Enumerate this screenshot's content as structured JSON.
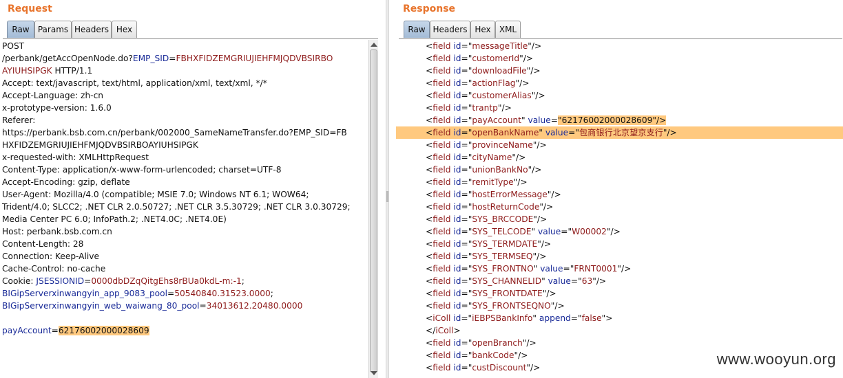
{
  "request": {
    "title": "Request",
    "tabs": [
      "Raw",
      "Params",
      "Headers",
      "Hex"
    ],
    "active_tab": "Raw",
    "lines": [
      [
        {
          "t": "POST"
        }
      ],
      [
        {
          "t": "/perbank/getAccOpenNode.do?"
        },
        {
          "t": "EMP_SID",
          "c": "k"
        },
        {
          "t": "="
        },
        {
          "t": "FBHXFIDZEMGRIUJIEHFMJQDVBSIRBO",
          "c": "v"
        }
      ],
      [
        {
          "t": "AYIUHSIPGK",
          "c": "v"
        },
        {
          "t": " HTTP/1.1"
        }
      ],
      [
        {
          "t": "Accept: text/javascript, text/html, application/xml, text/xml, */*"
        }
      ],
      [
        {
          "t": "Accept-Language: zh-cn"
        }
      ],
      [
        {
          "t": "x-prototype-version: 1.6.0"
        }
      ],
      [
        {
          "t": "Referer:"
        }
      ],
      [
        {
          "t": "https://perbank.bsb.com.cn/perbank/002000_SameNameTransfer.do?EMP_SID=FB"
        }
      ],
      [
        {
          "t": "HXFIDZEMGRIUJIEHFMJQDVBSIRBOAYIUHSIPGK"
        }
      ],
      [
        {
          "t": "x-requested-with: XMLHttpRequest"
        }
      ],
      [
        {
          "t": "Content-Type: application/x-www-form-urlencoded; charset=UTF-8"
        }
      ],
      [
        {
          "t": "Accept-Encoding: gzip, deflate"
        }
      ],
      [
        {
          "t": "User-Agent: Mozilla/4.0 (compatible; MSIE 7.0; Windows NT 6.1; WOW64;"
        }
      ],
      [
        {
          "t": "Trident/4.0; SLCC2; .NET CLR 2.0.50727; .NET CLR 3.5.30729; .NET CLR 3.0.30729;"
        }
      ],
      [
        {
          "t": "Media Center PC 6.0; InfoPath.2; .NET4.0C; .NET4.0E)"
        }
      ],
      [
        {
          "t": "Host: perbank.bsb.com.cn"
        }
      ],
      [
        {
          "t": "Content-Length: 28"
        }
      ],
      [
        {
          "t": "Connection: Keep-Alive"
        }
      ],
      [
        {
          "t": "Cache-Control: no-cache"
        }
      ],
      [
        {
          "t": "Cookie: "
        },
        {
          "t": "JSESSIONID",
          "c": "k"
        },
        {
          "t": "="
        },
        {
          "t": "0000dbDZqQitgEhs8rBUa0kdL-m:-1",
          "c": "v"
        },
        {
          "t": ";"
        }
      ],
      [
        {
          "t": "BIGipServerxinwangyin_app_9083_pool",
          "c": "k"
        },
        {
          "t": "="
        },
        {
          "t": "50540840.31523.0000",
          "c": "v"
        },
        {
          "t": ";"
        }
      ],
      [
        {
          "t": "BIGipServerxinwangyin_web_waiwang_80_pool",
          "c": "k"
        },
        {
          "t": "="
        },
        {
          "t": "34013612.20480.0000",
          "c": "v"
        }
      ],
      [
        {
          "t": ""
        }
      ],
      [
        {
          "t": "payAccount",
          "c": "k"
        },
        {
          "t": "="
        },
        {
          "t": "62176002000028609",
          "c": "hl"
        }
      ]
    ]
  },
  "response": {
    "title": "Response",
    "tabs": [
      "Raw",
      "Headers",
      "Hex",
      "XML"
    ],
    "active_tab": "Raw",
    "lines": [
      [
        {
          "t": "<"
        },
        {
          "t": "field",
          "c": "v"
        },
        {
          "t": " "
        },
        {
          "t": "id",
          "c": "k"
        },
        {
          "t": "=\""
        },
        {
          "t": "messageTitle",
          "c": "v"
        },
        {
          "t": "\"/>"
        }
      ],
      [
        {
          "t": "<"
        },
        {
          "t": "field",
          "c": "v"
        },
        {
          "t": " "
        },
        {
          "t": "id",
          "c": "k"
        },
        {
          "t": "=\""
        },
        {
          "t": "customerId",
          "c": "v"
        },
        {
          "t": "\"/>"
        }
      ],
      [
        {
          "t": "<"
        },
        {
          "t": "field",
          "c": "v"
        },
        {
          "t": " "
        },
        {
          "t": "id",
          "c": "k"
        },
        {
          "t": "=\""
        },
        {
          "t": "downloadFile",
          "c": "v"
        },
        {
          "t": "\"/>"
        }
      ],
      [
        {
          "t": "<"
        },
        {
          "t": "field",
          "c": "v"
        },
        {
          "t": " "
        },
        {
          "t": "id",
          "c": "k"
        },
        {
          "t": "=\""
        },
        {
          "t": "actionFlag",
          "c": "v"
        },
        {
          "t": "\"/>"
        }
      ],
      [
        {
          "t": "<"
        },
        {
          "t": "field",
          "c": "v"
        },
        {
          "t": " "
        },
        {
          "t": "id",
          "c": "k"
        },
        {
          "t": "=\""
        },
        {
          "t": "customerAlias",
          "c": "v"
        },
        {
          "t": "\"/>"
        }
      ],
      [
        {
          "t": "<"
        },
        {
          "t": "field",
          "c": "v"
        },
        {
          "t": " "
        },
        {
          "t": "id",
          "c": "k"
        },
        {
          "t": "=\""
        },
        {
          "t": "trantp",
          "c": "v"
        },
        {
          "t": "\"/>"
        }
      ],
      [
        {
          "t": "<"
        },
        {
          "t": "field",
          "c": "v"
        },
        {
          "t": " "
        },
        {
          "t": "id",
          "c": "k"
        },
        {
          "t": "=\""
        },
        {
          "t": "payAccount",
          "c": "v"
        },
        {
          "t": "\" "
        },
        {
          "t": "value",
          "c": "k"
        },
        {
          "t": "="
        },
        {
          "t": "\"62176002000028609\"/>",
          "c": "hl"
        }
      ],
      [
        {
          "t": "<"
        },
        {
          "t": "field",
          "c": "v"
        },
        {
          "t": " "
        },
        {
          "t": "id",
          "c": "k"
        },
        {
          "t": "=\""
        },
        {
          "t": "openBankName",
          "c": "v"
        },
        {
          "t": "\" "
        },
        {
          "t": "value",
          "c": "k"
        },
        {
          "t": "=\""
        },
        {
          "t": "包商银行北京望京支行",
          "c": "v"
        },
        {
          "t": "\"/>"
        }
      ],
      [
        {
          "t": "<"
        },
        {
          "t": "field",
          "c": "v"
        },
        {
          "t": " "
        },
        {
          "t": "id",
          "c": "k"
        },
        {
          "t": "=\""
        },
        {
          "t": "provinceName",
          "c": "v"
        },
        {
          "t": "\"/>"
        }
      ],
      [
        {
          "t": "<"
        },
        {
          "t": "field",
          "c": "v"
        },
        {
          "t": " "
        },
        {
          "t": "id",
          "c": "k"
        },
        {
          "t": "=\""
        },
        {
          "t": "cityName",
          "c": "v"
        },
        {
          "t": "\"/>"
        }
      ],
      [
        {
          "t": "<"
        },
        {
          "t": "field",
          "c": "v"
        },
        {
          "t": " "
        },
        {
          "t": "id",
          "c": "k"
        },
        {
          "t": "=\""
        },
        {
          "t": "unionBankNo",
          "c": "v"
        },
        {
          "t": "\"/>"
        }
      ],
      [
        {
          "t": "<"
        },
        {
          "t": "field",
          "c": "v"
        },
        {
          "t": " "
        },
        {
          "t": "id",
          "c": "k"
        },
        {
          "t": "=\""
        },
        {
          "t": "remitType",
          "c": "v"
        },
        {
          "t": "\"/>"
        }
      ],
      [
        {
          "t": "<"
        },
        {
          "t": "field",
          "c": "v"
        },
        {
          "t": " "
        },
        {
          "t": "id",
          "c": "k"
        },
        {
          "t": "=\""
        },
        {
          "t": "hostErrorMessage",
          "c": "v"
        },
        {
          "t": "\"/>"
        }
      ],
      [
        {
          "t": "<"
        },
        {
          "t": "field",
          "c": "v"
        },
        {
          "t": " "
        },
        {
          "t": "id",
          "c": "k"
        },
        {
          "t": "=\""
        },
        {
          "t": "hostReturnCode",
          "c": "v"
        },
        {
          "t": "\"/>"
        }
      ],
      [
        {
          "t": "<"
        },
        {
          "t": "field",
          "c": "v"
        },
        {
          "t": " "
        },
        {
          "t": "id",
          "c": "k"
        },
        {
          "t": "=\""
        },
        {
          "t": "SYS_BRCCODE",
          "c": "v"
        },
        {
          "t": "\"/>"
        }
      ],
      [
        {
          "t": "<"
        },
        {
          "t": "field",
          "c": "v"
        },
        {
          "t": " "
        },
        {
          "t": "id",
          "c": "k"
        },
        {
          "t": "=\""
        },
        {
          "t": "SYS_TELCODE",
          "c": "v"
        },
        {
          "t": "\" "
        },
        {
          "t": "value",
          "c": "k"
        },
        {
          "t": "=\""
        },
        {
          "t": "W00002",
          "c": "v"
        },
        {
          "t": "\"/>"
        }
      ],
      [
        {
          "t": "<"
        },
        {
          "t": "field",
          "c": "v"
        },
        {
          "t": " "
        },
        {
          "t": "id",
          "c": "k"
        },
        {
          "t": "=\""
        },
        {
          "t": "SYS_TERMDATE",
          "c": "v"
        },
        {
          "t": "\"/>"
        }
      ],
      [
        {
          "t": "<"
        },
        {
          "t": "field",
          "c": "v"
        },
        {
          "t": " "
        },
        {
          "t": "id",
          "c": "k"
        },
        {
          "t": "=\""
        },
        {
          "t": "SYS_TERMSEQ",
          "c": "v"
        },
        {
          "t": "\"/>"
        }
      ],
      [
        {
          "t": "<"
        },
        {
          "t": "field",
          "c": "v"
        },
        {
          "t": " "
        },
        {
          "t": "id",
          "c": "k"
        },
        {
          "t": "=\""
        },
        {
          "t": "SYS_FRONTNO",
          "c": "v"
        },
        {
          "t": "\" "
        },
        {
          "t": "value",
          "c": "k"
        },
        {
          "t": "=\""
        },
        {
          "t": "FRNT0001",
          "c": "v"
        },
        {
          "t": "\"/>"
        }
      ],
      [
        {
          "t": "<"
        },
        {
          "t": "field",
          "c": "v"
        },
        {
          "t": " "
        },
        {
          "t": "id",
          "c": "k"
        },
        {
          "t": "=\""
        },
        {
          "t": "SYS_CHANNELID",
          "c": "v"
        },
        {
          "t": "\" "
        },
        {
          "t": "value",
          "c": "k"
        },
        {
          "t": "=\""
        },
        {
          "t": "63",
          "c": "v"
        },
        {
          "t": "\"/>"
        }
      ],
      [
        {
          "t": "<"
        },
        {
          "t": "field",
          "c": "v"
        },
        {
          "t": " "
        },
        {
          "t": "id",
          "c": "k"
        },
        {
          "t": "=\""
        },
        {
          "t": "SYS_FRONTDATE",
          "c": "v"
        },
        {
          "t": "\"/>"
        }
      ],
      [
        {
          "t": "<"
        },
        {
          "t": "field",
          "c": "v"
        },
        {
          "t": " "
        },
        {
          "t": "id",
          "c": "k"
        },
        {
          "t": "=\""
        },
        {
          "t": "SYS_FRONTSEQNO",
          "c": "v"
        },
        {
          "t": "\"/>"
        }
      ],
      [
        {
          "t": "<"
        },
        {
          "t": "iColl",
          "c": "v"
        },
        {
          "t": " "
        },
        {
          "t": "id",
          "c": "k"
        },
        {
          "t": "=\""
        },
        {
          "t": "iEBPSBankInfo",
          "c": "v"
        },
        {
          "t": "\" "
        },
        {
          "t": "append",
          "c": "k"
        },
        {
          "t": "=\""
        },
        {
          "t": "false",
          "c": "v"
        },
        {
          "t": "\">"
        }
      ],
      [
        {
          "t": "</"
        },
        {
          "t": "iColl",
          "c": "v"
        },
        {
          "t": ">"
        }
      ],
      [
        {
          "t": "<"
        },
        {
          "t": "field",
          "c": "v"
        },
        {
          "t": " "
        },
        {
          "t": "id",
          "c": "k"
        },
        {
          "t": "=\""
        },
        {
          "t": "openBranch",
          "c": "v"
        },
        {
          "t": "\"/>"
        }
      ],
      [
        {
          "t": "<"
        },
        {
          "t": "field",
          "c": "v"
        },
        {
          "t": " "
        },
        {
          "t": "id",
          "c": "k"
        },
        {
          "t": "=\""
        },
        {
          "t": "bankCode",
          "c": "v"
        },
        {
          "t": "\"/>"
        }
      ],
      [
        {
          "t": "<"
        },
        {
          "t": "field",
          "c": "v"
        },
        {
          "t": " "
        },
        {
          "t": "id",
          "c": "k"
        },
        {
          "t": "=\""
        },
        {
          "t": "custDiscount",
          "c": "v"
        },
        {
          "t": "\"/>"
        }
      ]
    ],
    "highlighted_line_index": 7
  },
  "watermark": "www.wooyun.org",
  "colors": {
    "accent": "#e8742c",
    "highlight": "#ffc97f",
    "key": "#1a2b98",
    "value": "#8e1b1b"
  }
}
